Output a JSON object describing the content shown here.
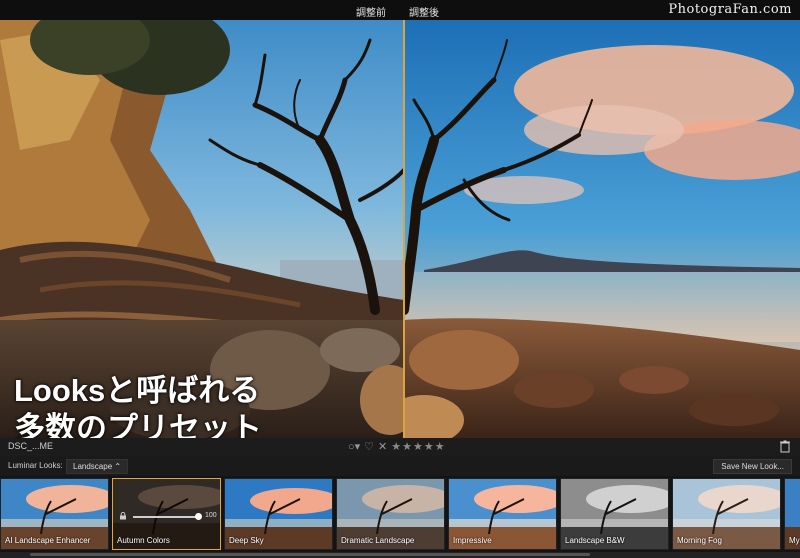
{
  "header": {
    "before_label": "調整前",
    "after_label": "調整後",
    "watermark": "PhotograFan.com"
  },
  "caption": {
    "line1": "Looksと呼ばれる",
    "line2": "多数のプリセット"
  },
  "infobar": {
    "filename": "DSC_...ME",
    "rating_stars": "★★★★★"
  },
  "looks": {
    "label": "Luminar Looks:",
    "category": "Landscape ⌃",
    "save_button": "Save New Look..."
  },
  "thumbnails": [
    {
      "name": "AI Landscape Enhancer",
      "style": "vivid",
      "active": false
    },
    {
      "name": "Autumn Colors",
      "style": "dark",
      "active": true,
      "amount": "100"
    },
    {
      "name": "Deep Sky",
      "style": "vivid",
      "active": false
    },
    {
      "name": "Dramatic Landscape",
      "style": "muted",
      "active": false
    },
    {
      "name": "Impressive",
      "style": "warm",
      "active": false
    },
    {
      "name": "Landscape B&W",
      "style": "bw",
      "active": false
    },
    {
      "name": "Morning Fog",
      "style": "fog",
      "active": false
    },
    {
      "name": "Mys",
      "style": "vivid",
      "active": false
    }
  ],
  "colors": {
    "accent": "#e4a83a",
    "divider": "#d9a441"
  }
}
